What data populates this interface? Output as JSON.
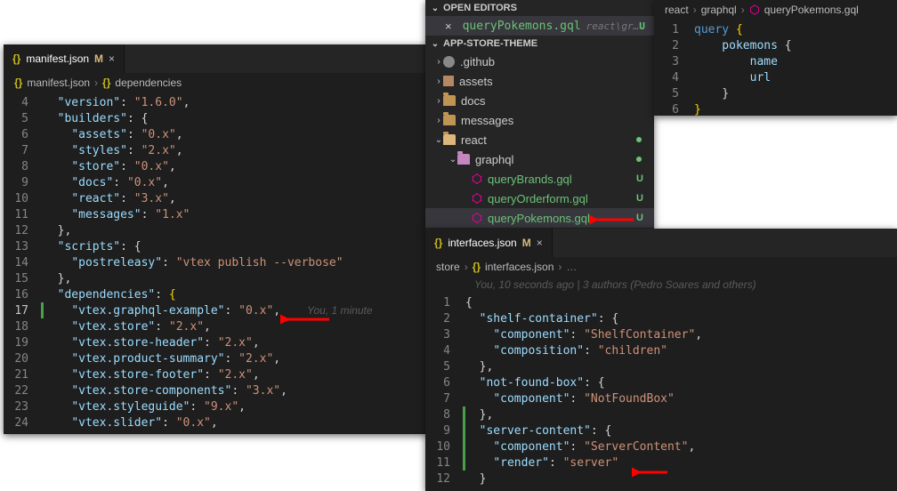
{
  "left": {
    "tab": {
      "name": "manifest.json",
      "modifier": "M"
    },
    "crumb": [
      "manifest.json",
      "dependencies"
    ],
    "lines": [
      {
        "n": 4,
        "ind": 2,
        "tokens": [
          [
            "k",
            "\"version\""
          ],
          [
            "p",
            ": "
          ],
          [
            "s",
            "\"1.6.0\""
          ],
          [
            "p",
            ","
          ]
        ]
      },
      {
        "n": 5,
        "ind": 2,
        "tokens": [
          [
            "k",
            "\"builders\""
          ],
          [
            "p",
            ": {"
          ]
        ]
      },
      {
        "n": 6,
        "ind": 4,
        "tokens": [
          [
            "k",
            "\"assets\""
          ],
          [
            "p",
            ": "
          ],
          [
            "s",
            "\"0.x\""
          ],
          [
            "p",
            ","
          ]
        ]
      },
      {
        "n": 7,
        "ind": 4,
        "tokens": [
          [
            "k",
            "\"styles\""
          ],
          [
            "p",
            ": "
          ],
          [
            "s",
            "\"2.x\""
          ],
          [
            "p",
            ","
          ]
        ]
      },
      {
        "n": 8,
        "ind": 4,
        "tokens": [
          [
            "k",
            "\"store\""
          ],
          [
            "p",
            ": "
          ],
          [
            "s",
            "\"0.x\""
          ],
          [
            "p",
            ","
          ]
        ]
      },
      {
        "n": 9,
        "ind": 4,
        "tokens": [
          [
            "k",
            "\"docs\""
          ],
          [
            "p",
            ": "
          ],
          [
            "s",
            "\"0.x\""
          ],
          [
            "p",
            ","
          ]
        ]
      },
      {
        "n": 10,
        "ind": 4,
        "tokens": [
          [
            "k",
            "\"react\""
          ],
          [
            "p",
            ": "
          ],
          [
            "s",
            "\"3.x\""
          ],
          [
            "p",
            ","
          ]
        ]
      },
      {
        "n": 11,
        "ind": 4,
        "tokens": [
          [
            "k",
            "\"messages\""
          ],
          [
            "p",
            ": "
          ],
          [
            "s",
            "\"1.x\""
          ]
        ]
      },
      {
        "n": 12,
        "ind": 2,
        "tokens": [
          [
            "p",
            "},"
          ]
        ]
      },
      {
        "n": 13,
        "ind": 2,
        "tokens": [
          [
            "k",
            "\"scripts\""
          ],
          [
            "p",
            ": {"
          ]
        ]
      },
      {
        "n": 14,
        "ind": 4,
        "tokens": [
          [
            "k",
            "\"postreleasy\""
          ],
          [
            "p",
            ": "
          ],
          [
            "s",
            "\"vtex publish --verbose\""
          ]
        ]
      },
      {
        "n": 15,
        "ind": 2,
        "tokens": [
          [
            "p",
            "},"
          ]
        ]
      },
      {
        "n": 16,
        "ind": 2,
        "tokens": [
          [
            "k",
            "\"dependencies\""
          ],
          [
            "p",
            ": "
          ],
          [
            "y",
            "{"
          ]
        ]
      },
      {
        "n": 17,
        "ind": 4,
        "hl": true,
        "mod": "green",
        "tokens": [
          [
            "k",
            "\"vtex.graphql-example\""
          ],
          [
            "p",
            ": "
          ],
          [
            "s",
            "\"0.x\""
          ],
          [
            "p",
            ","
          ]
        ],
        "blame": "You, 1 minute"
      },
      {
        "n": 18,
        "ind": 4,
        "tokens": [
          [
            "k",
            "\"vtex.store\""
          ],
          [
            "p",
            ": "
          ],
          [
            "s",
            "\"2.x\""
          ],
          [
            "p",
            ","
          ]
        ]
      },
      {
        "n": 19,
        "ind": 4,
        "tokens": [
          [
            "k",
            "\"vtex.store-header\""
          ],
          [
            "p",
            ": "
          ],
          [
            "s",
            "\"2.x\""
          ],
          [
            "p",
            ","
          ]
        ]
      },
      {
        "n": 20,
        "ind": 4,
        "tokens": [
          [
            "k",
            "\"vtex.product-summary\""
          ],
          [
            "p",
            ": "
          ],
          [
            "s",
            "\"2.x\""
          ],
          [
            "p",
            ","
          ]
        ]
      },
      {
        "n": 21,
        "ind": 4,
        "tokens": [
          [
            "k",
            "\"vtex.store-footer\""
          ],
          [
            "p",
            ": "
          ],
          [
            "s",
            "\"2.x\""
          ],
          [
            "p",
            ","
          ]
        ]
      },
      {
        "n": 22,
        "ind": 4,
        "tokens": [
          [
            "k",
            "\"vtex.store-components\""
          ],
          [
            "p",
            ": "
          ],
          [
            "s",
            "\"3.x\""
          ],
          [
            "p",
            ","
          ]
        ]
      },
      {
        "n": 23,
        "ind": 4,
        "tokens": [
          [
            "k",
            "\"vtex.styleguide\""
          ],
          [
            "p",
            ": "
          ],
          [
            "s",
            "\"9.x\""
          ],
          [
            "p",
            ","
          ]
        ]
      },
      {
        "n": 24,
        "ind": 4,
        "tokens": [
          [
            "k",
            "\"vtex.slider\""
          ],
          [
            "p",
            ": "
          ],
          [
            "s",
            "\"0.x\""
          ],
          [
            "p",
            ","
          ]
        ]
      }
    ]
  },
  "explorer": {
    "hdr1": "OPEN EDITORS",
    "openTab": {
      "name": "queryPokemons.gql",
      "hint": "react\\gr…",
      "u": "U"
    },
    "hdr2": "APP-STORE-THEME",
    "tree": [
      {
        "depth": 0,
        "chev": ">",
        "icon": "gh",
        "label": ".github"
      },
      {
        "depth": 0,
        "chev": ">",
        "icon": "parcel",
        "label": "assets"
      },
      {
        "depth": 0,
        "chev": ">",
        "icon": "folder",
        "label": "docs"
      },
      {
        "depth": 0,
        "chev": ">",
        "icon": "folder",
        "label": "messages"
      },
      {
        "depth": 0,
        "chev": "v",
        "icon": "folder-open",
        "label": "react",
        "dot": true
      },
      {
        "depth": 1,
        "chev": "v",
        "icon": "folder-pink",
        "label": "graphql",
        "dot": true
      },
      {
        "depth": 2,
        "icon": "gql",
        "label": "queryBrands.gql",
        "u": "U",
        "green": true
      },
      {
        "depth": 2,
        "icon": "gql",
        "label": "queryOrderform.gql",
        "u": "U",
        "green": true
      },
      {
        "depth": 2,
        "icon": "gql",
        "label": "queryPokemons.gql",
        "u": "U",
        "green": true,
        "sel": true
      }
    ]
  },
  "gqlEditor": {
    "crumb": [
      "react",
      "graphql",
      "queryPokemons.gql"
    ],
    "lines": [
      {
        "n": 1,
        "tokens": [
          [
            "kw",
            "query "
          ],
          [
            "y",
            "{"
          ]
        ]
      },
      {
        "n": 2,
        "tokens": [
          [
            "fld",
            "    pokemons "
          ],
          [
            "p",
            "{"
          ]
        ]
      },
      {
        "n": 3,
        "tokens": [
          [
            "fld",
            "        name"
          ]
        ]
      },
      {
        "n": 4,
        "tokens": [
          [
            "fld",
            "        url"
          ]
        ]
      },
      {
        "n": 5,
        "tokens": [
          [
            "p",
            "    }"
          ]
        ]
      },
      {
        "n": 6,
        "tokens": [
          [
            "y",
            "}"
          ]
        ]
      }
    ]
  },
  "interfaces": {
    "tab": {
      "name": "interfaces.json",
      "modifier": "M"
    },
    "crumb": [
      "store",
      "interfaces.json",
      "…"
    ],
    "blame": "You, 10 seconds ago | 3 authors (Pedro Soares and others)",
    "lines": [
      {
        "n": 1,
        "ind": 0,
        "tokens": [
          [
            "p",
            "{"
          ]
        ]
      },
      {
        "n": 2,
        "ind": 2,
        "tokens": [
          [
            "k",
            "\"shelf-container\""
          ],
          [
            "p",
            ": {"
          ]
        ]
      },
      {
        "n": 3,
        "ind": 4,
        "tokens": [
          [
            "k",
            "\"component\""
          ],
          [
            "p",
            ": "
          ],
          [
            "s",
            "\"ShelfContainer\""
          ],
          [
            "p",
            ","
          ]
        ]
      },
      {
        "n": 4,
        "ind": 4,
        "tokens": [
          [
            "k",
            "\"composition\""
          ],
          [
            "p",
            ": "
          ],
          [
            "s",
            "\"children\""
          ]
        ]
      },
      {
        "n": 5,
        "ind": 2,
        "tokens": [
          [
            "p",
            "},"
          ]
        ]
      },
      {
        "n": 6,
        "ind": 2,
        "tokens": [
          [
            "k",
            "\"not-found-box\""
          ],
          [
            "p",
            ": {"
          ]
        ]
      },
      {
        "n": 7,
        "ind": 4,
        "tokens": [
          [
            "k",
            "\"component\""
          ],
          [
            "p",
            ": "
          ],
          [
            "s",
            "\"NotFoundBox\""
          ]
        ]
      },
      {
        "n": 8,
        "ind": 2,
        "mod": "green",
        "tokens": [
          [
            "p",
            "},"
          ]
        ]
      },
      {
        "n": 9,
        "ind": 2,
        "mod": "green",
        "tokens": [
          [
            "k",
            "\"server-content\""
          ],
          [
            "p",
            ": {"
          ]
        ]
      },
      {
        "n": 10,
        "ind": 4,
        "mod": "green",
        "tokens": [
          [
            "k",
            "\"component\""
          ],
          [
            "p",
            ": "
          ],
          [
            "s",
            "\"ServerContent\""
          ],
          [
            "p",
            ","
          ]
        ]
      },
      {
        "n": 11,
        "ind": 4,
        "mod": "green",
        "tokens": [
          [
            "k",
            "\"render\""
          ],
          [
            "p",
            ": "
          ],
          [
            "s",
            "\"server\""
          ]
        ]
      },
      {
        "n": 12,
        "ind": 2,
        "tokens": [
          [
            "p",
            "}"
          ]
        ]
      }
    ]
  }
}
